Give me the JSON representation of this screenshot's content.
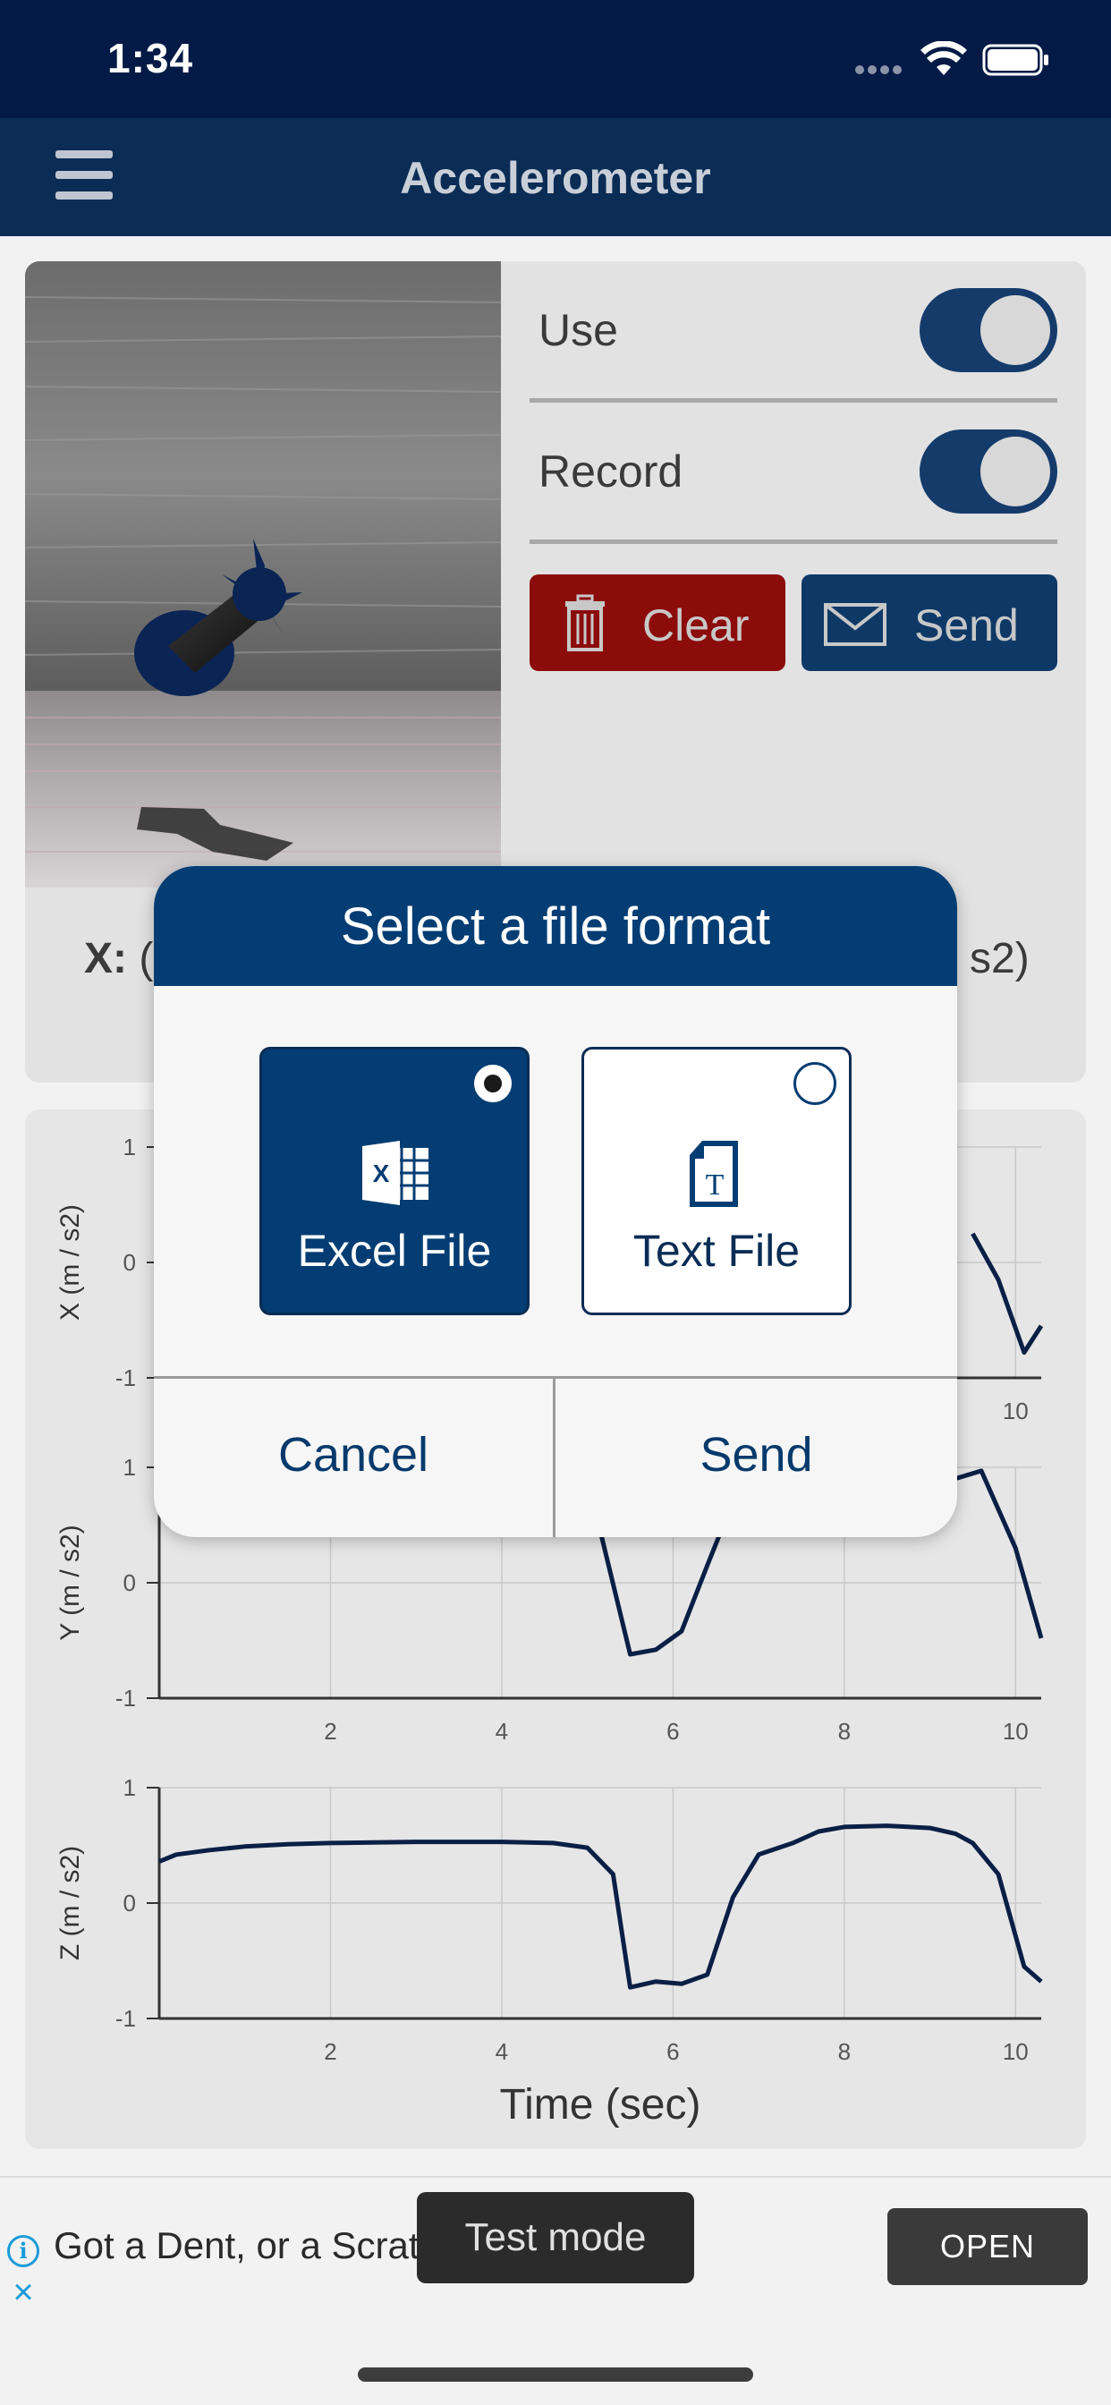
{
  "status_bar": {
    "time": "1:34"
  },
  "nav": {
    "title": "Accelerometer"
  },
  "controls": {
    "use_label": "Use",
    "use_on": true,
    "record_label": "Record",
    "record_on": true,
    "clear_label": "Clear",
    "send_label": "Send"
  },
  "readout": {
    "x_prefix": "X:",
    "x_open": "(",
    "x_unit_suffix": "s2)"
  },
  "dialog": {
    "title": "Select a file format",
    "options": [
      {
        "label": "Excel File",
        "selected": true,
        "icon": "excel-icon"
      },
      {
        "label": "Text File",
        "selected": false,
        "icon": "text-file-icon"
      }
    ],
    "cancel_label": "Cancel",
    "send_label": "Send"
  },
  "ad": {
    "text": "Got a Dent, or a Scratch",
    "badge": "Test mode",
    "open_label": "OPEN"
  },
  "colors": {
    "primary": "#043d73",
    "nav": "#0a2c55",
    "status": "#021a45",
    "clear_red": "#8c0c0c"
  },
  "chart_data": [
    {
      "type": "line",
      "ylabel": "X (m / s2)",
      "ylim": [
        -1,
        1
      ],
      "yticks": [
        "1",
        "0",
        "-1"
      ],
      "xticks": [
        "2",
        "4",
        "6",
        "8",
        "10"
      ],
      "x": [
        9.5,
        9.8,
        10.1,
        10.3
      ],
      "y": [
        0.25,
        -0.15,
        -0.78,
        -0.55
      ]
    },
    {
      "type": "line",
      "ylabel": "Y (m / s2)",
      "ylim": [
        -1,
        1
      ],
      "yticks": [
        "1",
        "0",
        "-1"
      ],
      "xticks": [
        "2",
        "4",
        "6",
        "8",
        "10"
      ],
      "x": [
        5.15,
        5.5,
        5.8,
        6.1,
        6.4,
        6.6,
        9.2,
        9.6,
        10.0,
        10.3
      ],
      "y": [
        0.45,
        -0.62,
        -0.58,
        -0.42,
        0.15,
        0.52,
        0.88,
        0.97,
        0.3,
        -0.48
      ]
    },
    {
      "type": "line",
      "ylabel": "Z (m / s2)",
      "xlabel": "Time (sec)",
      "ylim": [
        -1,
        1
      ],
      "yticks": [
        "1",
        "0",
        "-1"
      ],
      "xticks": [
        "2",
        "4",
        "6",
        "8",
        "10"
      ],
      "x": [
        0,
        0.2,
        0.6,
        1.0,
        1.5,
        2.0,
        3.0,
        4.0,
        4.6,
        5.0,
        5.3,
        5.5,
        5.8,
        6.1,
        6.4,
        6.7,
        7.0,
        7.4,
        7.7,
        8.0,
        8.5,
        9.0,
        9.3,
        9.5,
        9.8,
        10.1,
        10.3
      ],
      "y": [
        0.36,
        0.42,
        0.46,
        0.49,
        0.51,
        0.52,
        0.53,
        0.53,
        0.52,
        0.48,
        0.25,
        -0.73,
        -0.68,
        -0.7,
        -0.62,
        0.05,
        0.42,
        0.52,
        0.62,
        0.66,
        0.67,
        0.65,
        0.6,
        0.52,
        0.25,
        -0.55,
        -0.68
      ]
    }
  ]
}
